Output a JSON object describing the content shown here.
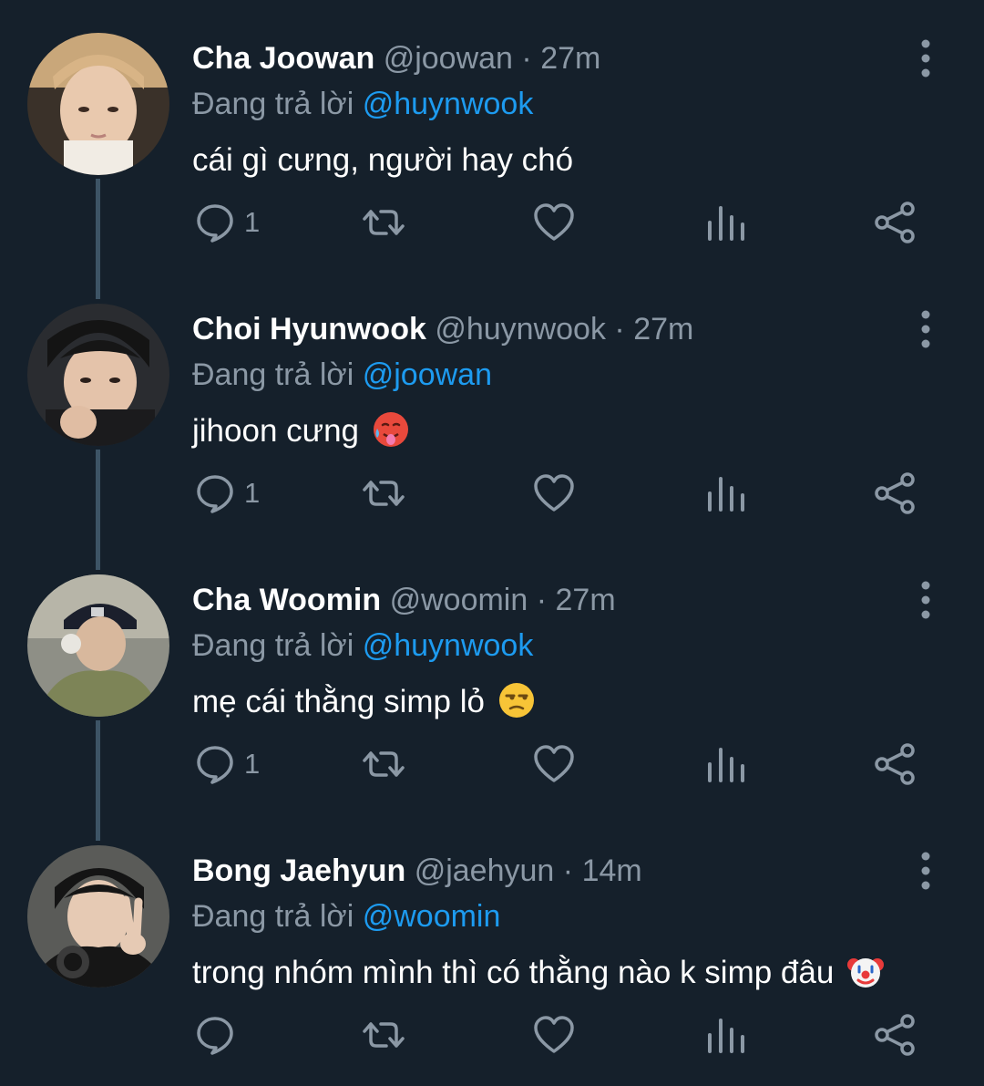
{
  "reply_prefix": "Đang trả lời",
  "colors": {
    "background": "#15202b",
    "name": "#ffffff",
    "muted": "#8b98a5",
    "link": "#1d9bf0",
    "thread": "#3d5466"
  },
  "icons": {
    "reply": "reply-icon",
    "retweet": "retweet-icon",
    "like": "heart-icon",
    "views": "views-icon",
    "share": "share-icon",
    "more": "more-vertical-icon"
  },
  "tweets": [
    {
      "name": "Cha Joowan",
      "handle": "@joowan",
      "separator": "·",
      "time": "27m",
      "reply_to": "@huynwook",
      "text": "cái gì cưng, người hay chó",
      "emoji": "",
      "reply_count": "1"
    },
    {
      "name": "Choi Hyunwook",
      "handle": "@huynwook",
      "separator": "·",
      "time": "27m",
      "reply_to": "@joowan",
      "text": "jihoon cưng",
      "emoji": "hot-face-emoji",
      "reply_count": "1"
    },
    {
      "name": "Cha Woomin",
      "handle": "@woomin",
      "separator": "·",
      "time": "27m",
      "reply_to": "@huynwook",
      "text": "mẹ cái thằng simp lỏ",
      "emoji": "unamused-face-emoji",
      "reply_count": "1"
    },
    {
      "name": "Bong Jaehyun",
      "handle": "@jaehyun",
      "separator": "·",
      "time": "14m",
      "reply_to": "@woomin",
      "text": "trong nhóm mình thì có thằng nào k simp đâu",
      "emoji": "clown-face-emoji",
      "reply_count": ""
    }
  ]
}
